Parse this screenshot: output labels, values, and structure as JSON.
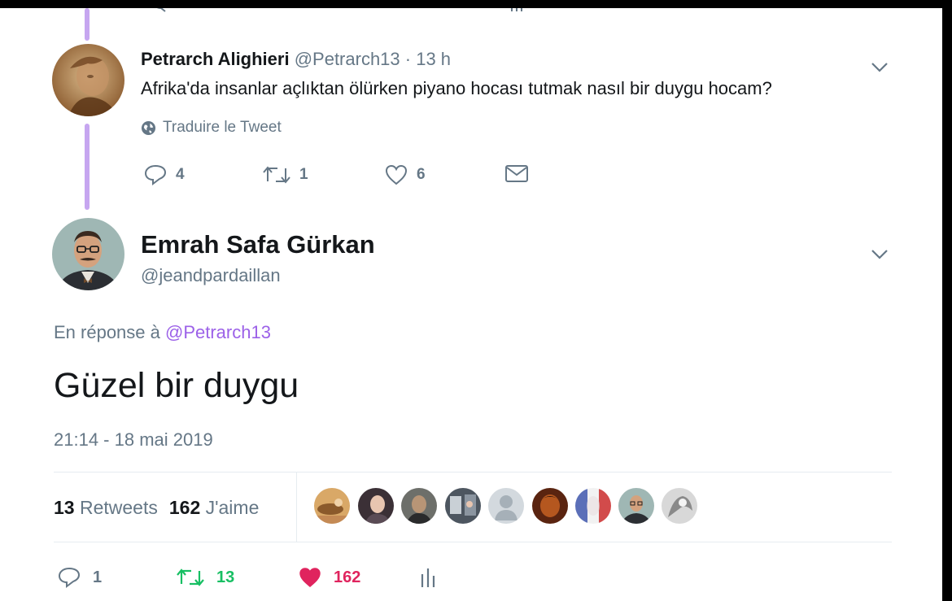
{
  "parent_tweet": {
    "author_name": "Petrarch Alighieri",
    "handle": "@Petrarch13",
    "separator": " · ",
    "time_ago": "13 h",
    "text": "Afrika'da insanlar açlıktan ölürken piyano hocası tutmak nasıl bir duygu hocam?",
    "translate_label": "Traduire le Tweet",
    "reply_count": "4",
    "retweet_count": "1",
    "like_count": "6"
  },
  "main_tweet": {
    "author_name": "Emrah Safa Gürkan",
    "handle": "@jeandpardaillan",
    "reply_prefix": "En réponse à ",
    "reply_to_handle": "@Petrarch13",
    "text": "Güzel bir duygu",
    "timestamp": "21:14 - 18 mai 2019",
    "retweets_count": "13",
    "retweets_label": "Retweets",
    "likes_count": "162",
    "likes_label": "J'aime",
    "reply_count": "1",
    "retweet_count": "13",
    "like_count": "162"
  },
  "colors": {
    "thread_line": "#c6a6f0",
    "link": "#9c61e8",
    "retweet_active": "#17bf63",
    "like_active": "#e0245e",
    "muted": "#657786"
  },
  "icons": [
    "reply-icon",
    "retweet-icon",
    "like-icon",
    "message-icon",
    "globe-icon",
    "chevron-down-icon",
    "analytics-icon"
  ]
}
